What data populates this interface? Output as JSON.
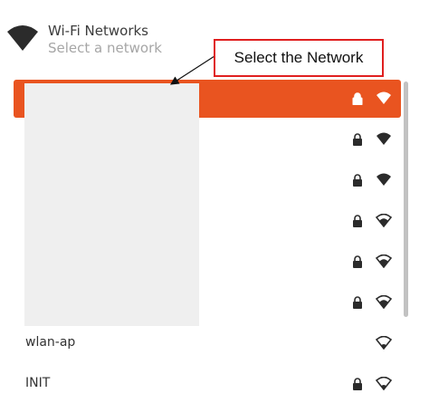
{
  "header": {
    "title": "Wi-Fi Networks",
    "subtitle": "Select a network",
    "icon": "wifi-icon"
  },
  "callout": {
    "text": "Select the Network",
    "border_color": "#e01f1f"
  },
  "accent_color": "#e95420",
  "networks": [
    {
      "name": "",
      "secured": true,
      "signal": "full",
      "selected": true
    },
    {
      "name": "",
      "secured": true,
      "signal": "full"
    },
    {
      "name": "",
      "secured": true,
      "signal": "full"
    },
    {
      "name": "",
      "secured": true,
      "signal": "medium"
    },
    {
      "name": "",
      "secured": true,
      "signal": "medium"
    },
    {
      "name": "",
      "secured": true,
      "signal": "medium"
    },
    {
      "name": "wlan-ap",
      "secured": false,
      "signal": "low"
    },
    {
      "name": "INIT",
      "secured": true,
      "signal": "low"
    }
  ]
}
